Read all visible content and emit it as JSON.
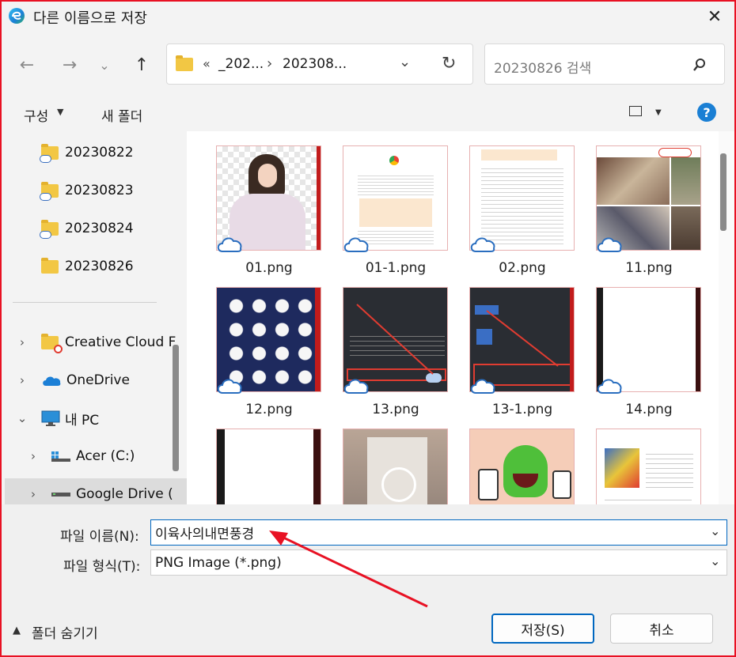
{
  "window": {
    "title": "다른 이름으로 저장",
    "close_glyph": "✕"
  },
  "address": {
    "ellipsis": "«",
    "crumbs": [
      "_202...",
      "202308..."
    ],
    "separator": "›"
  },
  "search": {
    "placeholder": "20230826 검색"
  },
  "toolbar": {
    "organize": "구성",
    "new_folder": "새 폴더",
    "help": "?"
  },
  "nav": {
    "folders": [
      "20230822",
      "20230823",
      "20230824",
      "20230826"
    ],
    "items": [
      "Creative Cloud F",
      "OneDrive",
      "내 PC",
      "Acer (C:)",
      "Google Drive ("
    ]
  },
  "files": [
    "01.png",
    "01-1.png",
    "02.png",
    "11.png",
    "12.png",
    "13.png",
    "13-1.png",
    "14.png"
  ],
  "form": {
    "filename_label": "파일 이름(N):",
    "filename_value": "이육사의내면풍경",
    "filetype_label": "파일 형식(T):",
    "filetype_value": "PNG Image (*.png)"
  },
  "footer": {
    "hide_folders": "폴더 숨기기",
    "save": "저장(S)",
    "cancel": "취소"
  },
  "colors": {
    "accent": "#0067c0",
    "annotation": "#e81123"
  }
}
